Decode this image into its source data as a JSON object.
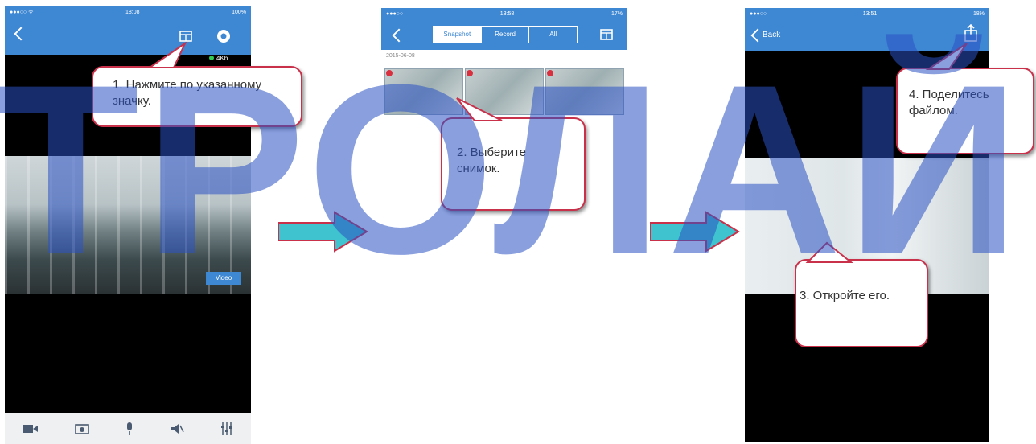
{
  "watermark": {
    "text": "ТРОЛАЙ"
  },
  "phone1": {
    "status_time": "18:08",
    "status_battery": "100%",
    "resolution_badge": "4Kb",
    "live_label": "Video",
    "toolbar_icons": [
      "video-icon",
      "snapshot-icon",
      "microphone-icon",
      "speaker-icon",
      "settings-sliders-icon"
    ]
  },
  "phone2": {
    "status_time": "13:58",
    "status_battery": "17%",
    "tabs": [
      "Snapshot",
      "Record",
      "All"
    ],
    "date_label": "2015-06-08"
  },
  "phone3": {
    "status_time": "13:51",
    "status_battery": "18%",
    "back_label": "Back"
  },
  "callouts": {
    "c1": "1. Нажмите по указанному значку.",
    "c2": "2. Выберите снимок.",
    "c3": "3. Откройте его.",
    "c4": "4. Поделитесь файлом."
  },
  "colors": {
    "nav_blue": "#3d87d3",
    "callout_border": "#c9304a",
    "arrow_cyan": "#3fc4cf",
    "watermark": "#2b52c4"
  }
}
